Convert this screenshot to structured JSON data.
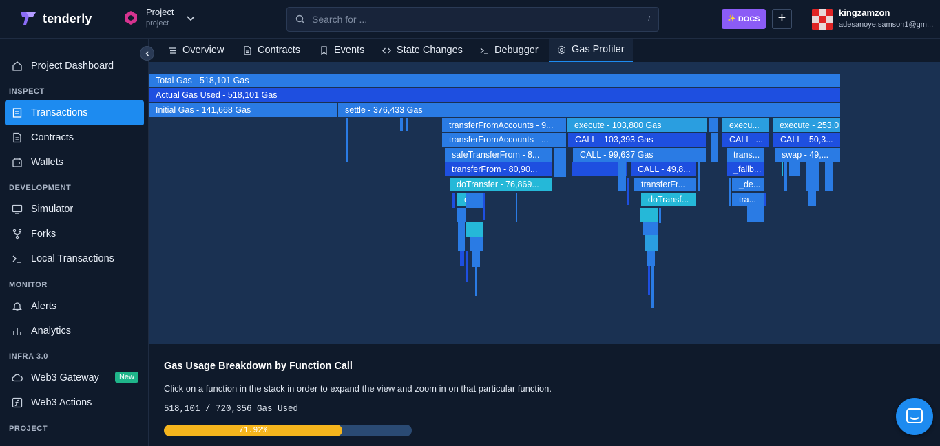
{
  "brand": {
    "name": "tenderly"
  },
  "project": {
    "label": "Project",
    "slug": "project"
  },
  "search": {
    "placeholder": "Search for ...",
    "shortcut": "/"
  },
  "header": {
    "docs_label": "DOCS",
    "plus_label": "+"
  },
  "user": {
    "name": "kingzamzon",
    "email": "adesanoye.samson1@gm..."
  },
  "sidebar": {
    "top_item": {
      "label": "Project Dashboard",
      "icon": "home-icon"
    },
    "sections": [
      {
        "title": "INSPECT",
        "items": [
          {
            "label": "Transactions",
            "icon": "transactions-icon",
            "active": true
          },
          {
            "label": "Contracts",
            "icon": "document-icon"
          },
          {
            "label": "Wallets",
            "icon": "wallet-icon"
          }
        ]
      },
      {
        "title": "DEVELOPMENT",
        "items": [
          {
            "label": "Simulator",
            "icon": "monitor-icon"
          },
          {
            "label": "Forks",
            "icon": "fork-icon"
          },
          {
            "label": "Local Transactions",
            "icon": "terminal-icon"
          }
        ]
      },
      {
        "title": "MONITOR",
        "items": [
          {
            "label": "Alerts",
            "icon": "bell-icon"
          },
          {
            "label": "Analytics",
            "icon": "bar-chart-icon"
          }
        ]
      },
      {
        "title": "INFRA 3.0",
        "items": [
          {
            "label": "Web3 Gateway",
            "icon": "cloud-icon",
            "badge": "New"
          },
          {
            "label": "Web3 Actions",
            "icon": "function-icon"
          }
        ]
      },
      {
        "title": "PROJECT",
        "items": []
      }
    ]
  },
  "tabs": [
    {
      "label": "Overview",
      "icon": "list-icon"
    },
    {
      "label": "Contracts",
      "icon": "document-icon"
    },
    {
      "label": "Events",
      "icon": "bookmark-icon"
    },
    {
      "label": "State Changes",
      "icon": "code-icon"
    },
    {
      "label": "Debugger",
      "icon": "terminal-icon"
    },
    {
      "label": "Gas Profiler",
      "icon": "gear-icon",
      "active": true
    }
  ],
  "flame": {
    "colors": {
      "bg": "#1a3152",
      "light": "#2a9ee0",
      "mid": "#2a7be4",
      "dark": "#1e4fe0",
      "teal": "#25b8d8"
    },
    "labels": [
      "Total Gas - 518,101 Gas",
      "Actual Gas Used - 518,101 Gas",
      "Initial Gas - 141,668 Gas",
      "settle - 376,433 Gas",
      "transferFromAccounts - 9...",
      "transferFromAccounts - ...",
      "safeTransferFrom - 8...",
      "transferFrom - 80,90...",
      "doTransfer - 76,869...",
      "onTr",
      "execute - 103,800 Gas",
      "CALL - 103,393 Gas",
      "CALL - 99,637 Gas",
      "CALL - 49,8...",
      "transferFr...",
      "doTransf...",
      "execu...",
      "CALL -...",
      "trans...",
      "_fallb...",
      "_de...",
      "tra...",
      "execute - 253,0",
      "CALL - 50,3...",
      "swap - 49,..."
    ]
  },
  "breakdown": {
    "title": "Gas Usage Breakdown by Function Call",
    "description": "Click on a function in the stack in order to expand the view and zoom in on that particular function.",
    "used_text": "518,101 / 720,356 Gas Used",
    "percent_label": "71.92%",
    "percent_value": 0.7192,
    "bar_color": "#f5b51d",
    "track_color": "#2a4a73"
  }
}
